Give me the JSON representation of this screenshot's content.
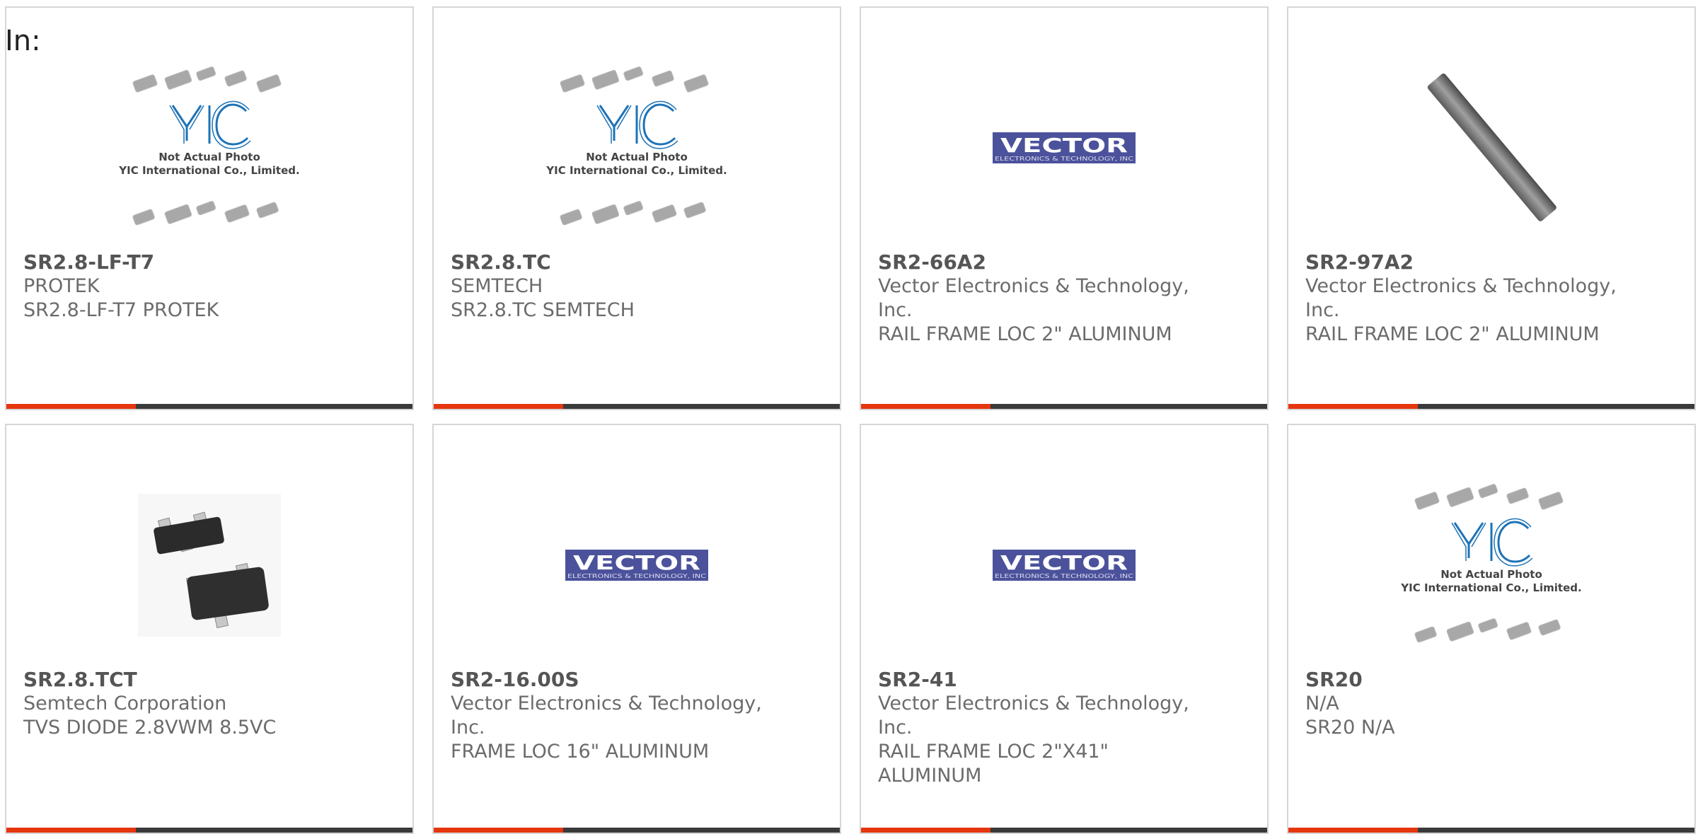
{
  "filter_label": "In:",
  "colors": {
    "accent": "#e5360f",
    "bar": "#3a3a3a",
    "vector_blue": "#4b529b",
    "yic_blue": "#1e73b6"
  },
  "cards": [
    {
      "part": "SR2.8-LF-T7",
      "lines": [
        "PROTEK",
        "SR2.8-LF-T7 PROTEK"
      ],
      "image": "yic-placeholder",
      "yic": {
        "note1": "Not Actual Photo",
        "note2": "YIC International Co., Limited."
      }
    },
    {
      "part": "SR2.8.TC",
      "lines": [
        "SEMTECH",
        "SR2.8.TC SEMTECH"
      ],
      "image": "yic-placeholder",
      "yic": {
        "note1": "Not Actual Photo",
        "note2": "YIC International Co., Limited."
      }
    },
    {
      "part": "SR2-66A2",
      "lines": [
        "Vector Electronics & Technology,",
        "Inc.",
        "RAIL FRAME LOC 2\" ALUMINUM"
      ],
      "image": "vector-logo",
      "vector": {
        "word": "VECTOR",
        "sub": "ELECTRONICS & TECHNOLOGY, INC"
      }
    },
    {
      "part": "SR2-97A2",
      "lines": [
        "Vector Electronics & Technology,",
        "Inc.",
        "RAIL FRAME LOC 2\" ALUMINUM"
      ],
      "image": "rail-photo"
    },
    {
      "part": "SR2.8.TCT",
      "lines": [
        "Semtech Corporation",
        "TVS DIODE 2.8VWM 8.5VC"
      ],
      "image": "chip-photo"
    },
    {
      "part": "SR2-16.00S",
      "lines": [
        "Vector Electronics & Technology,",
        "Inc.",
        "FRAME LOC 16\" ALUMINUM"
      ],
      "image": "vector-logo",
      "vector": {
        "word": "VECTOR",
        "sub": "ELECTRONICS & TECHNOLOGY, INC"
      }
    },
    {
      "part": "SR2-41",
      "lines": [
        "Vector Electronics & Technology,",
        "Inc.",
        "RAIL FRAME LOC 2\"X41\"",
        "ALUMINUM"
      ],
      "image": "vector-logo",
      "vector": {
        "word": "VECTOR",
        "sub": "ELECTRONICS & TECHNOLOGY, INC"
      }
    },
    {
      "part": "SR20",
      "lines": [
        "N/A",
        "SR20 N/A"
      ],
      "image": "yic-placeholder",
      "yic": {
        "note1": "Not Actual Photo",
        "note2": "YIC International Co., Limited."
      }
    }
  ]
}
